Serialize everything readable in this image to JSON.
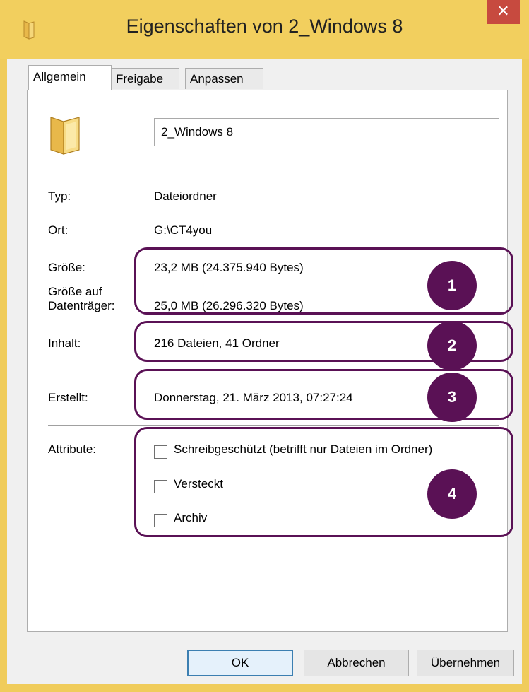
{
  "window": {
    "title": "Eigenschaften von 2_Windows 8",
    "close_glyph": "✕",
    "icon": "folder-icon"
  },
  "tabs": [
    {
      "label": "Allgemein",
      "active": true
    },
    {
      "label": "Freigabe",
      "active": false
    },
    {
      "label": "Anpassen",
      "active": false
    }
  ],
  "general": {
    "folder_icon": "folder-icon",
    "name_value": "2_Windows 8",
    "type_label": "Typ:",
    "type_value": "Dateiordner",
    "location_label": "Ort:",
    "location_value": "G:\\CT4you",
    "size_label": "Größe:",
    "size_value": "23,2 MB (24.375.940 Bytes)",
    "size_on_disk_label_line1": "Größe auf",
    "size_on_disk_label_line2": "Datenträger:",
    "size_on_disk_value": "25,0 MB (26.296.320 Bytes)",
    "contents_label": "Inhalt:",
    "contents_value": "216 Dateien, 41 Ordner",
    "created_label": "Erstellt:",
    "created_value": "Donnerstag, 21. März 2013, 07:27:24",
    "attributes_label": "Attribute:",
    "attributes": [
      {
        "label": "Schreibgeschützt (betrifft nur Dateien im Ordner)",
        "checked": false,
        "accel": "S"
      },
      {
        "label": "Versteckt",
        "checked": false,
        "accel": "V"
      },
      {
        "label": "Archiv",
        "checked": false,
        "accel": "A"
      }
    ]
  },
  "callouts": [
    "1",
    "2",
    "3",
    "4"
  ],
  "buttons": {
    "ok": "OK",
    "cancel": "Abbrechen",
    "apply": "Übernehmen"
  },
  "colors": {
    "titlebar": "#f2cf5e",
    "close": "#c74a3f",
    "callout": "#5a1155",
    "default_button_border": "#3c7fb1"
  }
}
